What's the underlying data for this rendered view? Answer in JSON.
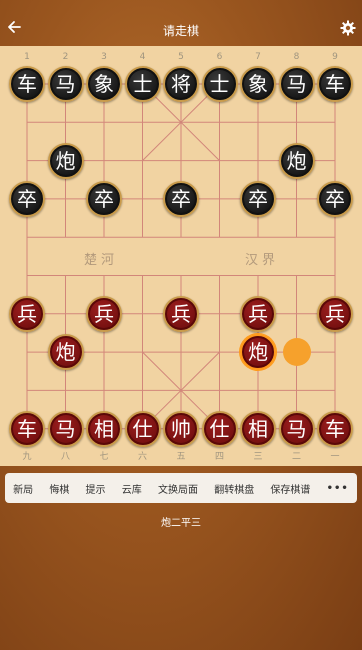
{
  "header": {
    "title": "请走棋",
    "back_icon": "back-arrow-icon",
    "settings_icon": "gear-icon"
  },
  "board": {
    "top_labels": [
      "1",
      "2",
      "3",
      "4",
      "5",
      "6",
      "7",
      "8",
      "9"
    ],
    "bottom_labels": [
      "九",
      "八",
      "七",
      "六",
      "五",
      "四",
      "三",
      "二",
      "一"
    ],
    "river_left": "楚河",
    "river_right": "汉界",
    "pieces": [
      {
        "file": 0,
        "rank": 0,
        "side": "black",
        "char": "车"
      },
      {
        "file": 1,
        "rank": 0,
        "side": "black",
        "char": "马"
      },
      {
        "file": 2,
        "rank": 0,
        "side": "black",
        "char": "象"
      },
      {
        "file": 3,
        "rank": 0,
        "side": "black",
        "char": "士"
      },
      {
        "file": 4,
        "rank": 0,
        "side": "black",
        "char": "将"
      },
      {
        "file": 5,
        "rank": 0,
        "side": "black",
        "char": "士"
      },
      {
        "file": 6,
        "rank": 0,
        "side": "black",
        "char": "象"
      },
      {
        "file": 7,
        "rank": 0,
        "side": "black",
        "char": "马"
      },
      {
        "file": 8,
        "rank": 0,
        "side": "black",
        "char": "车"
      },
      {
        "file": 1,
        "rank": 2,
        "side": "black",
        "char": "炮"
      },
      {
        "file": 7,
        "rank": 2,
        "side": "black",
        "char": "炮"
      },
      {
        "file": 0,
        "rank": 3,
        "side": "black",
        "char": "卒"
      },
      {
        "file": 2,
        "rank": 3,
        "side": "black",
        "char": "卒"
      },
      {
        "file": 4,
        "rank": 3,
        "side": "black",
        "char": "卒"
      },
      {
        "file": 6,
        "rank": 3,
        "side": "black",
        "char": "卒"
      },
      {
        "file": 8,
        "rank": 3,
        "side": "black",
        "char": "卒"
      },
      {
        "file": 0,
        "rank": 6,
        "side": "red",
        "char": "兵"
      },
      {
        "file": 2,
        "rank": 6,
        "side": "red",
        "char": "兵"
      },
      {
        "file": 4,
        "rank": 6,
        "side": "red",
        "char": "兵"
      },
      {
        "file": 6,
        "rank": 6,
        "side": "red",
        "char": "兵"
      },
      {
        "file": 8,
        "rank": 6,
        "side": "red",
        "char": "兵"
      },
      {
        "file": 1,
        "rank": 7,
        "side": "red",
        "char": "炮"
      },
      {
        "file": 6,
        "rank": 7,
        "side": "red",
        "char": "炮",
        "selected": true
      },
      {
        "file": 0,
        "rank": 9,
        "side": "red",
        "char": "车"
      },
      {
        "file": 1,
        "rank": 9,
        "side": "red",
        "char": "马"
      },
      {
        "file": 2,
        "rank": 9,
        "side": "red",
        "char": "相"
      },
      {
        "file": 3,
        "rank": 9,
        "side": "red",
        "char": "仕"
      },
      {
        "file": 4,
        "rank": 9,
        "side": "red",
        "char": "帅"
      },
      {
        "file": 5,
        "rank": 9,
        "side": "red",
        "char": "仕"
      },
      {
        "file": 6,
        "rank": 9,
        "side": "red",
        "char": "相"
      },
      {
        "file": 7,
        "rank": 9,
        "side": "red",
        "char": "马"
      },
      {
        "file": 8,
        "rank": 9,
        "side": "red",
        "char": "车"
      }
    ],
    "move_target": {
      "file": 7,
      "rank": 7
    },
    "colors": {
      "board": "#f1d3a2",
      "line": "#d2867a",
      "black_piece": "#161616",
      "red_piece": "#751010",
      "highlight": "#f6a12c"
    }
  },
  "toolbar": {
    "buttons": [
      "新局",
      "悔棋",
      "提示",
      "云库",
      "文换局面",
      "翻转棋盘",
      "保存棋谱"
    ],
    "more_icon": "more-dots-icon",
    "more_label": "•••"
  },
  "status": {
    "last_move": "炮二平三"
  }
}
